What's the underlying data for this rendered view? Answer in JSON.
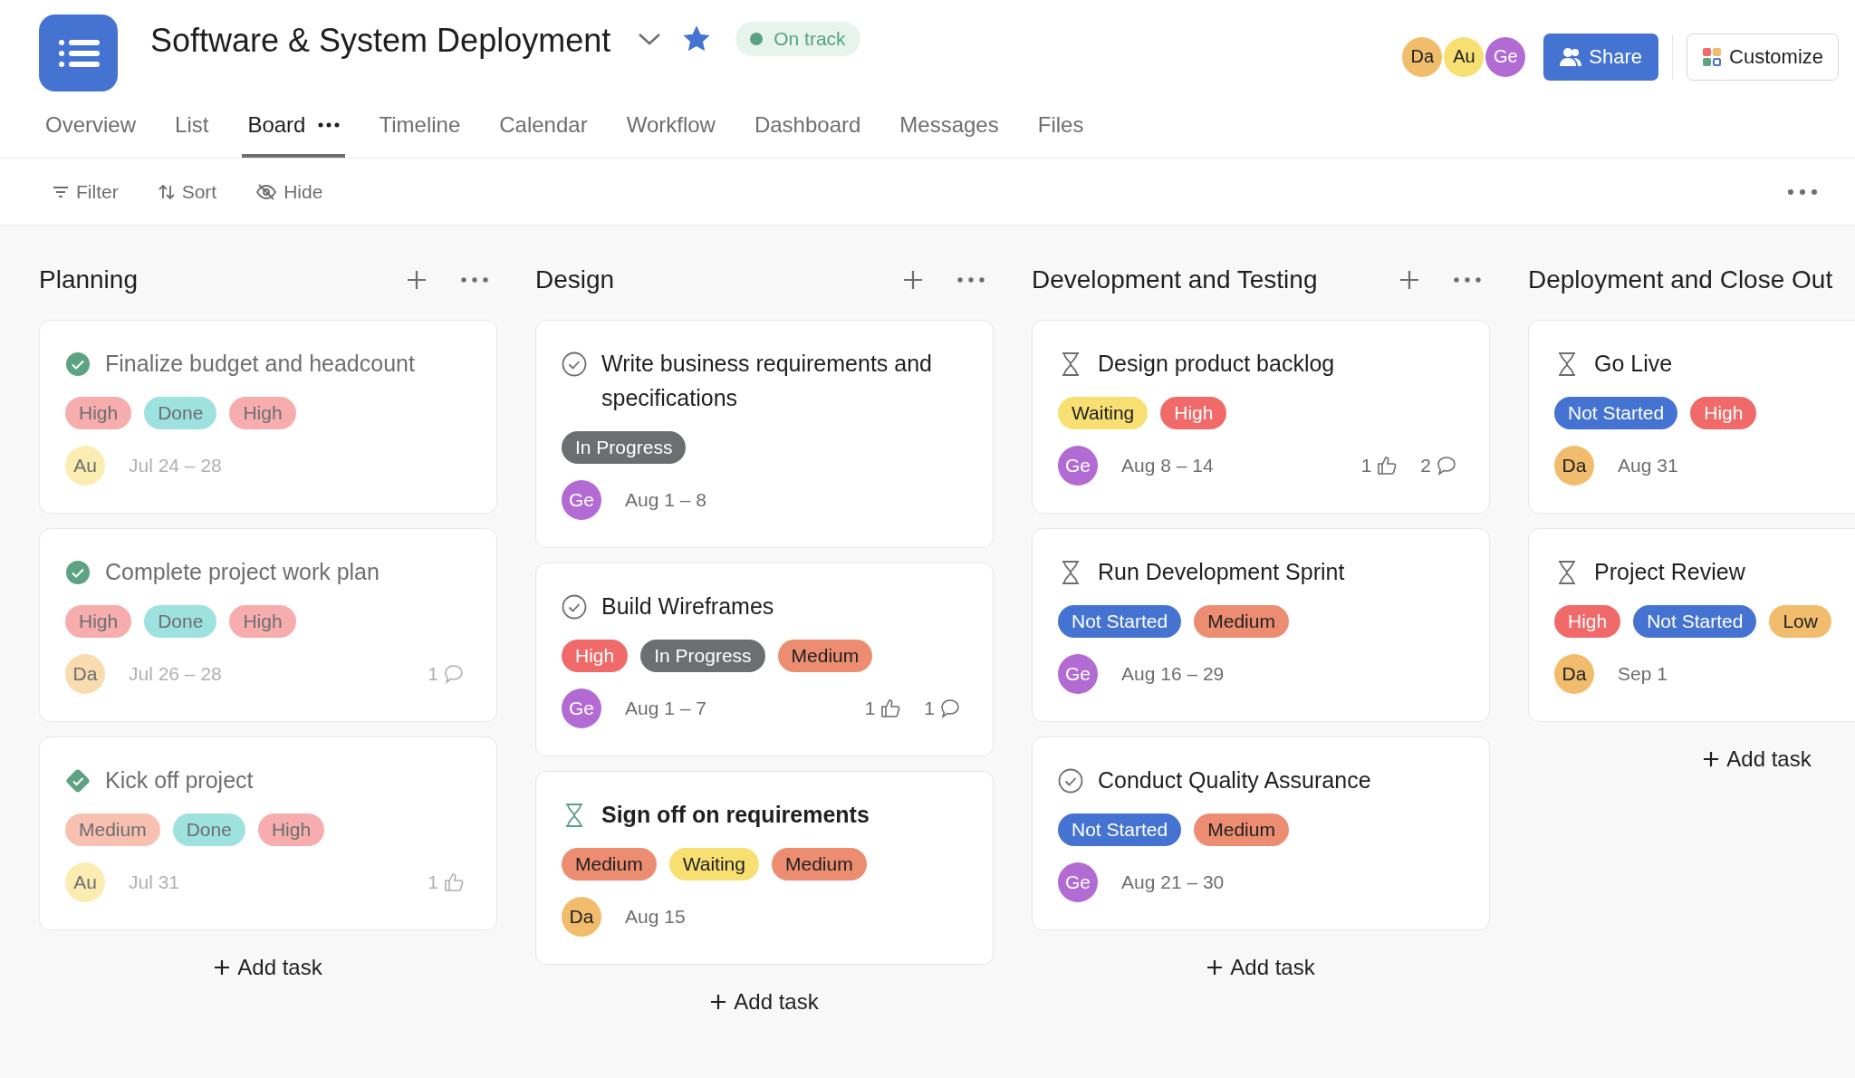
{
  "project": {
    "title": "Software & System Deployment",
    "starred": true,
    "status": {
      "label": "On track",
      "color": "#58a182"
    }
  },
  "members": [
    {
      "initials": "Da",
      "color": "#f1bd6c"
    },
    {
      "initials": "Au",
      "color": "#f8df72"
    },
    {
      "initials": "Ge",
      "color": "#b36bd4"
    }
  ],
  "share_button": "Share",
  "customize_button": "Customize",
  "tabs": [
    {
      "label": "Overview",
      "selected": false
    },
    {
      "label": "List",
      "selected": false
    },
    {
      "label": "Board",
      "selected": true
    },
    {
      "label": "Timeline",
      "selected": false
    },
    {
      "label": "Calendar",
      "selected": false
    },
    {
      "label": "Workflow",
      "selected": false
    },
    {
      "label": "Dashboard",
      "selected": false
    },
    {
      "label": "Messages",
      "selected": false
    },
    {
      "label": "Files",
      "selected": false
    }
  ],
  "toolbar": [
    {
      "kind": "filter",
      "label": "Filter"
    },
    {
      "kind": "sort",
      "label": "Sort"
    },
    {
      "kind": "hide",
      "label": "Hide"
    }
  ],
  "columns": [
    {
      "title": "Planning",
      "add_task": "Add task",
      "cards": [
        {
          "title": "Finalize budget and headcount",
          "kind": "check",
          "completed": true,
          "selected": false,
          "tags": [
            {
              "label": "High",
              "color": "#f7adad"
            },
            {
              "label": "Done",
              "color": "#9ee2df"
            },
            {
              "label": "High",
              "color": "#f7adad"
            }
          ],
          "assignee": {
            "initials": "Au",
            "color": "#fbedb1"
          },
          "dates": "Jul 24 – 28"
        },
        {
          "title": "Complete project work plan",
          "kind": "check",
          "completed": true,
          "selected": false,
          "tags": [
            {
              "label": "High",
              "color": "#f7adad"
            },
            {
              "label": "Done",
              "color": "#9ee2df"
            },
            {
              "label": "High",
              "color": "#f7adad"
            }
          ],
          "assignee": {
            "initials": "Da",
            "color": "#f8dbae"
          },
          "dates": "Jul 26 – 28",
          "comments": "1"
        },
        {
          "title": "Kick off project",
          "kind": "milestone",
          "completed": true,
          "selected": false,
          "tags": [
            {
              "label": "Medium",
              "color": "#f7c0b1"
            },
            {
              "label": "Done",
              "color": "#9ee2df"
            },
            {
              "label": "High",
              "color": "#f7adad"
            }
          ],
          "assignee": {
            "initials": "Au",
            "color": "#fbedb1"
          },
          "dates": "Jul 31",
          "likes": "1"
        }
      ]
    },
    {
      "title": "Design",
      "add_task": "Add task",
      "cards": [
        {
          "title": "Write business requirements and specifications",
          "kind": "check",
          "completed": false,
          "selected": false,
          "tags": [
            {
              "label": "In Progress",
              "color": "#6d6e6f"
            }
          ],
          "assignee": {
            "initials": "Ge",
            "color": "#b36bd4"
          },
          "dates": "Aug 1 – 8"
        },
        {
          "title": "Build Wireframes",
          "kind": "check",
          "completed": false,
          "selected": false,
          "tags": [
            {
              "label": "High",
              "color": "#f06a6a"
            },
            {
              "label": "In Progress",
              "color": "#6d6e6f"
            },
            {
              "label": "Medium",
              "color": "#ec8d71"
            }
          ],
          "assignee": {
            "initials": "Ge",
            "color": "#b36bd4"
          },
          "dates": "Aug 1 – 7",
          "likes": "1",
          "comments": "1"
        },
        {
          "title": "Sign off on requirements",
          "kind": "hourglass",
          "completed": false,
          "selected": true,
          "tags": [
            {
              "label": "Medium",
              "color": "#ec8d71"
            },
            {
              "label": "Waiting",
              "color": "#f8df72"
            },
            {
              "label": "Medium",
              "color": "#ec8d71"
            }
          ],
          "assignee": {
            "initials": "Da",
            "color": "#f1bd6c"
          },
          "dates": "Aug 15"
        }
      ]
    },
    {
      "title": "Development and Testing",
      "add_task": "Add task",
      "cards": [
        {
          "title": "Design product backlog",
          "kind": "hourglass",
          "completed": false,
          "selected": false,
          "tags": [
            {
              "label": "Waiting",
              "color": "#f8df72"
            },
            {
              "label": "High",
              "color": "#f06a6a"
            }
          ],
          "assignee": {
            "initials": "Ge",
            "color": "#b36bd4"
          },
          "dates": "Aug 8 – 14",
          "likes": "1",
          "comments": "2"
        },
        {
          "title": "Run Development Sprint",
          "kind": "hourglass",
          "completed": false,
          "selected": false,
          "tags": [
            {
              "label": "Not Started",
              "color": "#4573d2"
            },
            {
              "label": "Medium",
              "color": "#ec8d71"
            }
          ],
          "assignee": {
            "initials": "Ge",
            "color": "#b36bd4"
          },
          "dates": "Aug 16 – 29"
        },
        {
          "title": "Conduct Quality Assurance",
          "kind": "check",
          "completed": false,
          "selected": false,
          "tags": [
            {
              "label": "Not Started",
              "color": "#4573d2"
            },
            {
              "label": "Medium",
              "color": "#ec8d71"
            }
          ],
          "assignee": {
            "initials": "Ge",
            "color": "#b36bd4"
          },
          "dates": "Aug 21 – 30"
        }
      ]
    },
    {
      "title": "Deployment and Close Out",
      "add_task": "Add task",
      "cards": [
        {
          "title": "Go Live",
          "kind": "hourglass",
          "completed": false,
          "selected": false,
          "tags": [
            {
              "label": "Not Started",
              "color": "#4573d2"
            },
            {
              "label": "High",
              "color": "#f06a6a"
            }
          ],
          "assignee": {
            "initials": "Da",
            "color": "#f1bd6c"
          },
          "dates": "Aug 31"
        },
        {
          "title": "Project Review",
          "kind": "hourglass",
          "completed": false,
          "selected": false,
          "tags": [
            {
              "label": "High",
              "color": "#f06a6a"
            },
            {
              "label": "Not Started",
              "color": "#4573d2"
            },
            {
              "label": "Low",
              "color": "#f1bd6c"
            }
          ],
          "assignee": {
            "initials": "Da",
            "color": "#f1bd6c"
          },
          "dates": "Sep 1"
        }
      ]
    }
  ]
}
